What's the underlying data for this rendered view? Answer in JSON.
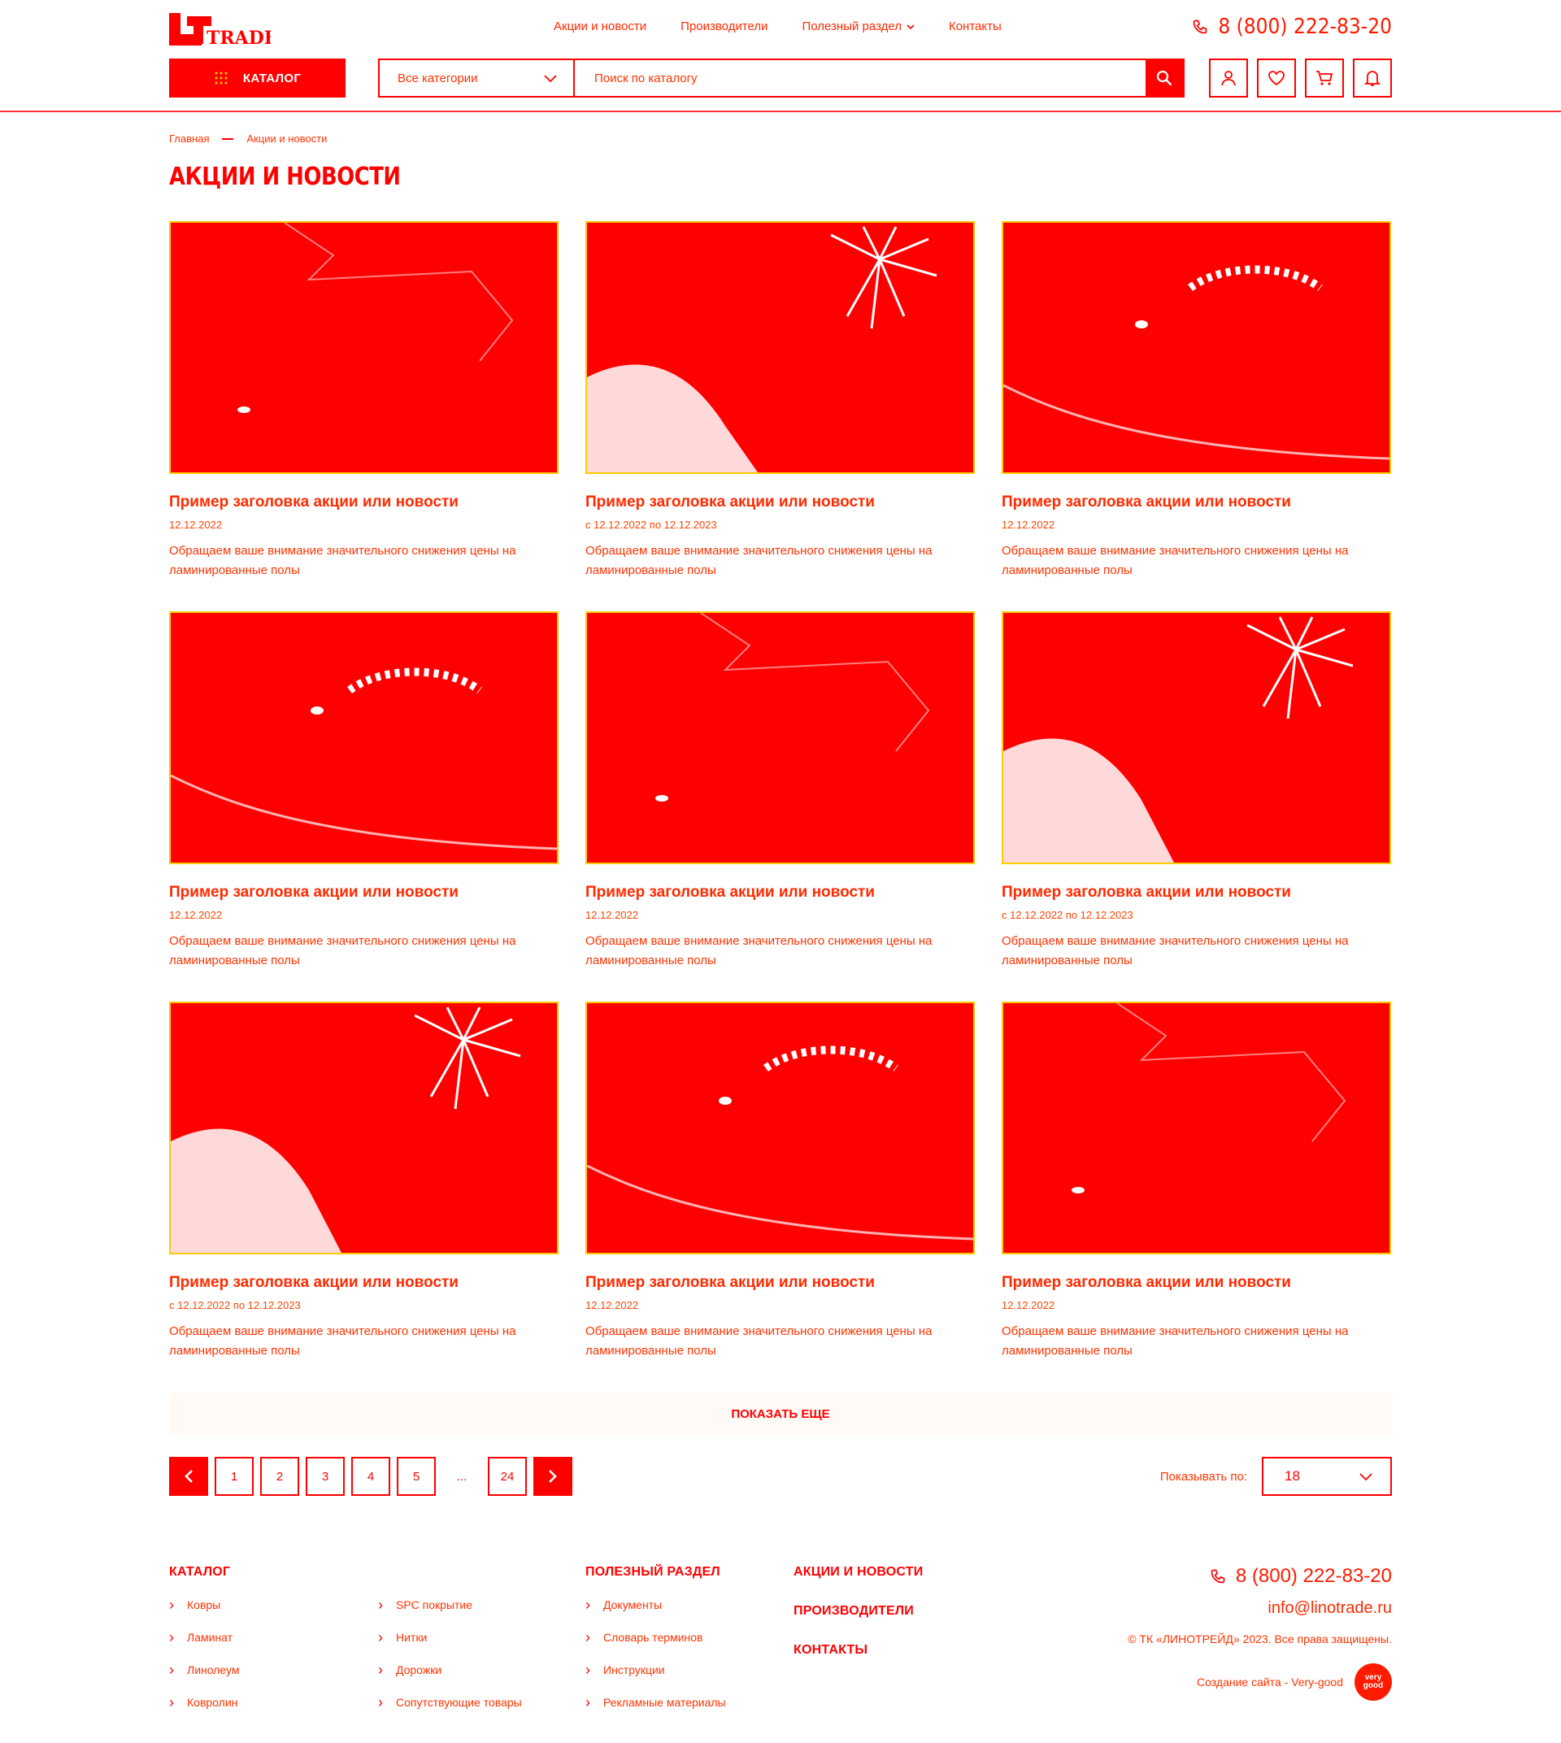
{
  "header": {
    "logo_text": "TRADE",
    "nav": [
      {
        "label": "Акции и новости"
      },
      {
        "label": "Производители"
      },
      {
        "label": "Полезный раздел"
      },
      {
        "label": "Контакты"
      }
    ],
    "phone": "8 (800) 222-83-20",
    "catalog_label": "КАТАЛОГ",
    "category_select": "Все категории",
    "search_placeholder": "Поиск по каталогу"
  },
  "breadcrumb": {
    "home": "Главная",
    "current": "Акции и новости"
  },
  "page_title": "АКЦИИ И НОВОСТИ",
  "cards": [
    {
      "title": "Пример заголовка акции или новости",
      "date": "12.12.2022",
      "desc": "Обращаем ваше внимание значительного снижения цены на ламинированные полы"
    },
    {
      "title": "Пример заголовка акции или новости",
      "date": "с 12.12.2022 по 12.12.2023",
      "desc": "Обращаем ваше внимание значительного снижения цены на ламинированные полы"
    },
    {
      "title": "Пример заголовка акции или новости",
      "date": "12.12.2022",
      "desc": "Обращаем ваше внимание значительного снижения цены на ламинированные полы"
    },
    {
      "title": "Пример заголовка акции или новости",
      "date": "12.12.2022",
      "desc": "Обращаем ваше внимание значительного снижения цены на ламинированные полы"
    },
    {
      "title": "Пример заголовка акции или новости",
      "date": "12.12.2022",
      "desc": "Обращаем ваше внимание значительного снижения цены на ламинированные полы"
    },
    {
      "title": "Пример заголовка акции или новости",
      "date": "с 12.12.2022 по 12.12.2023",
      "desc": "Обращаем ваше внимание значительного снижения цены на ламинированные полы"
    },
    {
      "title": "Пример заголовка акции или новости",
      "date": "с 12.12.2022 по 12.12.2023",
      "desc": "Обращаем ваше внимание значительного снижения цены на ламинированные полы"
    },
    {
      "title": "Пример заголовка акции или новости",
      "date": "12.12.2022",
      "desc": "Обращаем ваше внимание значительного снижения цены на ламинированные полы"
    },
    {
      "title": "Пример заголовка акции или новости",
      "date": "12.12.2022",
      "desc": "Обращаем ваше внимание значительного снижения цены на ламинированные полы"
    }
  ],
  "show_more": "ПОКАЗАТЬ ЕЩЕ",
  "pagination": {
    "pages": [
      "1",
      "2",
      "3",
      "4",
      "5"
    ],
    "ellipsis": "...",
    "last": "24"
  },
  "per_page": {
    "label": "Показывать по:",
    "value": "18"
  },
  "footer": {
    "catalog_head": "КАТАЛОГ",
    "catalog_col1": [
      "Ковры",
      "Ламинат",
      "Линолеум",
      "Ковролин"
    ],
    "catalog_col2": [
      "SPC покрытие",
      "Нитки",
      "Дорожки",
      "Сопутствующие товары"
    ],
    "useful_head": "ПОЛЕЗНЫЙ РАЗДЕЛ",
    "useful_items": [
      "Документы",
      "Словарь терминов",
      "Инструкции",
      "Рекламные материалы"
    ],
    "big_links": [
      "АКЦИИ И НОВОСТИ",
      "ПРОИЗВОДИТЕЛИ",
      "КОНТАКТЫ"
    ],
    "phone": "8 (800) 222-83-20",
    "email": "info@linotrade.ru",
    "copyright": "© ТК «ЛИНОТРЕЙД» 2023. Все права защищены.",
    "credit": "Создание сайта - Very-good",
    "badge": "very good"
  },
  "colors": {
    "accent": "#ff0000",
    "border_yellow": "#ffcc00"
  }
}
